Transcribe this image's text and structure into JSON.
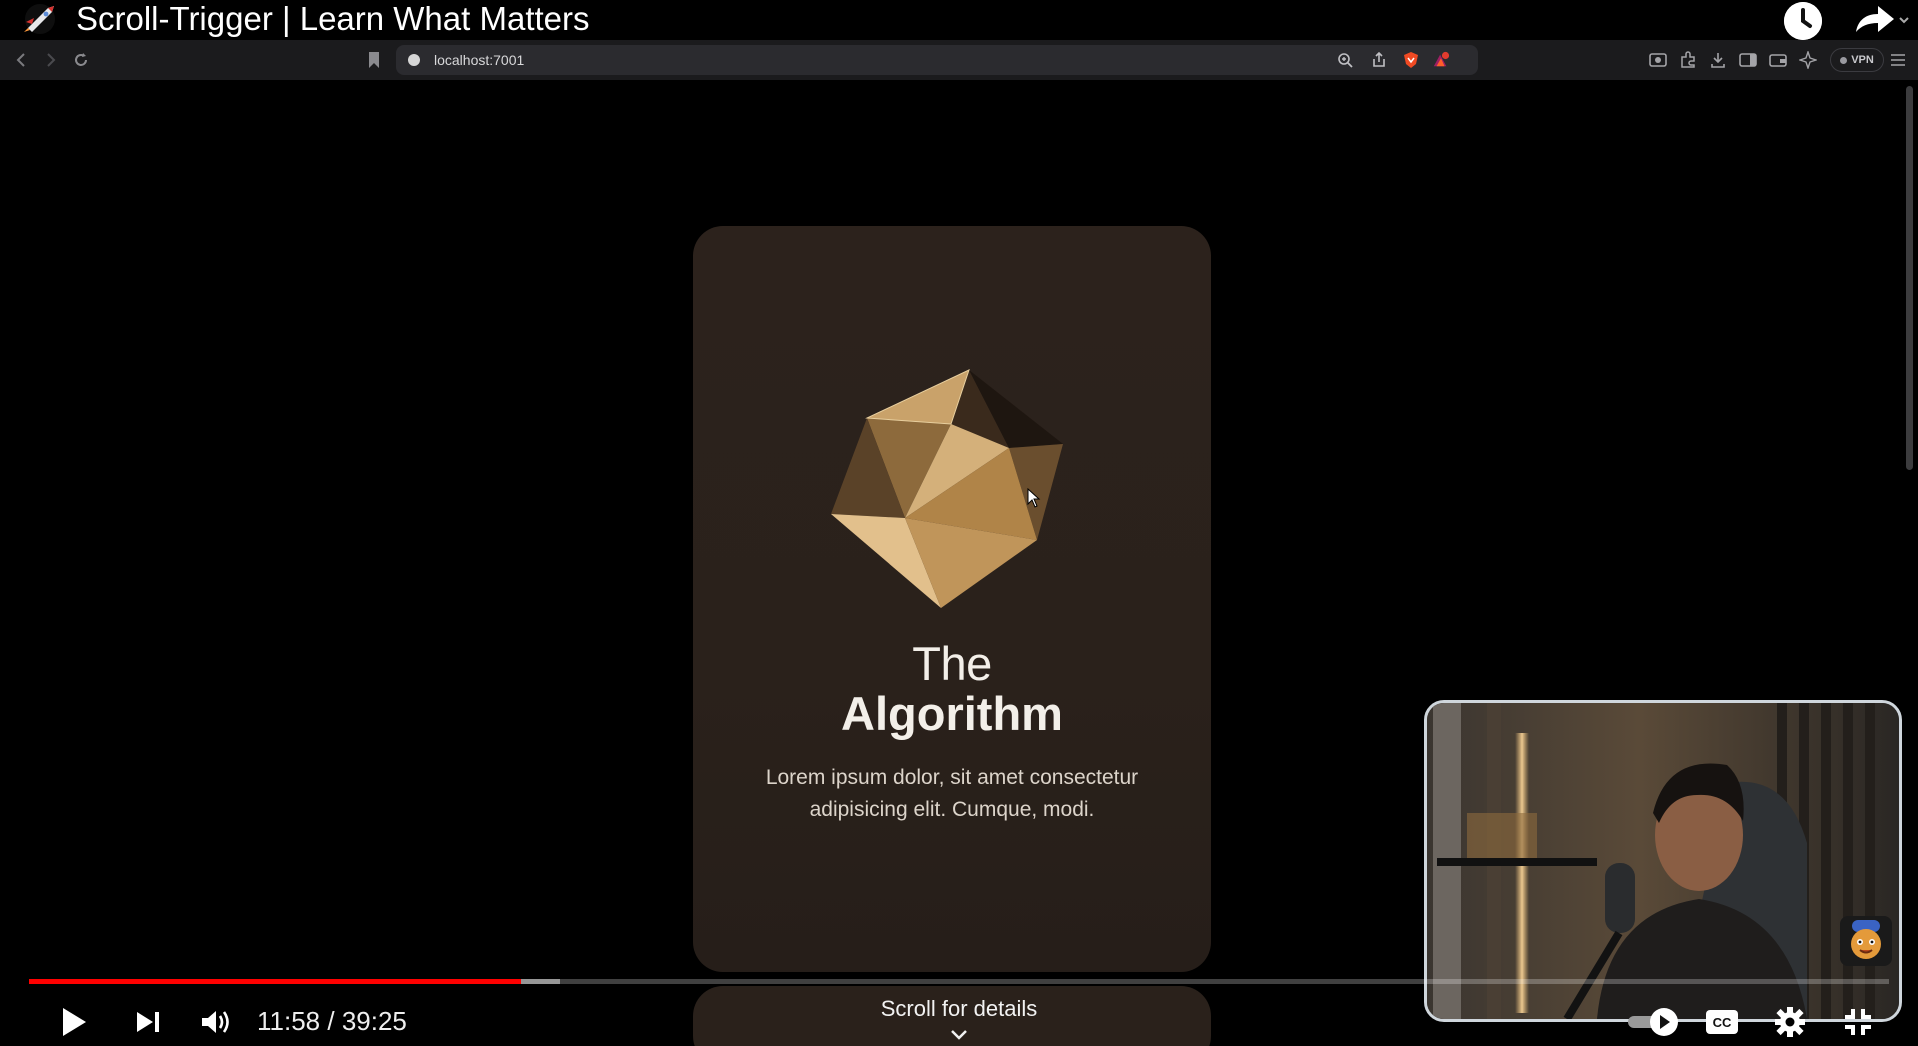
{
  "video": {
    "title": "Scroll-Trigger | Learn What Matters",
    "time_current": "11:58",
    "time_total": "39:25",
    "time_separator": " / ",
    "progress_played_fraction": 0.2645,
    "progress_buffered_fraction": 0.2855
  },
  "browser": {
    "url": "localhost:7001",
    "vpn_label": "VPN"
  },
  "card": {
    "title_line1": "The",
    "title_line2": "Algorithm",
    "description": "Lorem ipsum dolor, sit amet consectetur adipisicing elit. Cumque, modi."
  },
  "scroll_hint": "Scroll for details",
  "colors": {
    "progress_red": "#ff0000",
    "card_bg": "#2c221c",
    "gem_gold": "#b58a52",
    "browser_toolbar": "#1b1b1d"
  },
  "icons": {
    "channel": "rocket-icon",
    "watch_later": "clock-icon",
    "share": "share-arrow-icon",
    "play": "play-icon",
    "next": "next-track-icon",
    "volume": "volume-icon",
    "autoplay": "autoplay-toggle-icon",
    "captions": "cc-icon",
    "settings": "gear-icon",
    "fullscreen_exit": "exit-fullscreen-icon"
  }
}
